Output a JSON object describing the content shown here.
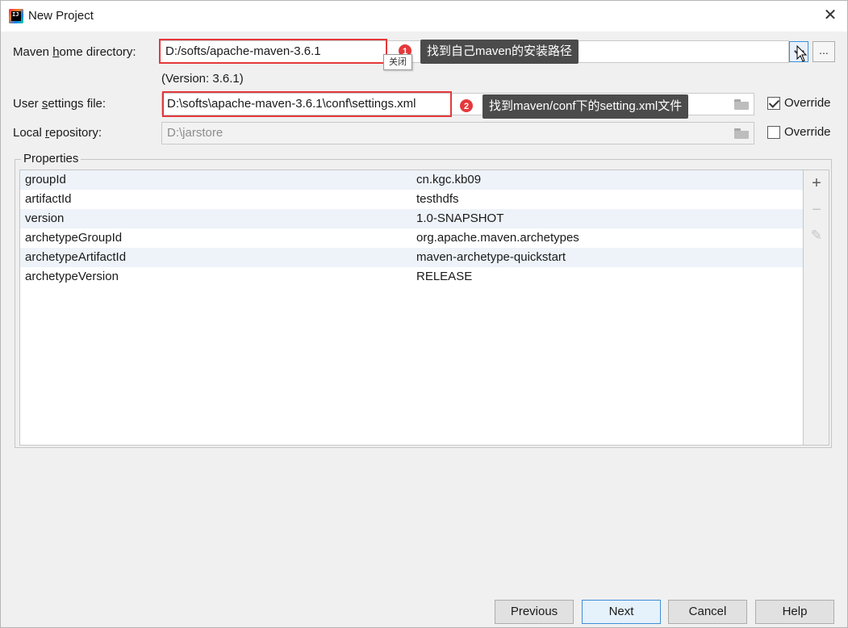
{
  "window": {
    "title": "New Project",
    "close_glyph": "✕"
  },
  "maven_home": {
    "label_before": "Maven ",
    "label_underlined": "h",
    "label_after": "ome directory:",
    "value": "D:/softs/apache-maven-3.6.1",
    "version": "(Version: 3.6.1)",
    "browse_label": "..."
  },
  "user_settings": {
    "label_before": "User ",
    "label_underlined": "s",
    "label_after": "ettings file:",
    "value": "D:\\softs\\apache-maven-3.6.1\\conf\\settings.xml",
    "override_label": "Override",
    "override_checked": true
  },
  "local_repo": {
    "label_before": "Local ",
    "label_underlined": "r",
    "label_after": "epository:",
    "value": "D:\\jarstore",
    "override_label": "Override",
    "override_checked": false
  },
  "annotations": {
    "badge1": "1",
    "callout1": "找到自己maven的安装路径",
    "tooltip_close": "关闭",
    "badge2": "2",
    "callout2": "找到maven/conf下的setting.xml文件",
    "highlight_color": "#e5383b"
  },
  "properties": {
    "title": "Properties",
    "rows": [
      {
        "key": "groupId",
        "value": "cn.kgc.kb09"
      },
      {
        "key": "artifactId",
        "value": "testhdfs"
      },
      {
        "key": "version",
        "value": "1.0-SNAPSHOT"
      },
      {
        "key": "archetypeGroupId",
        "value": "org.apache.maven.archetypes"
      },
      {
        "key": "archetypeArtifactId",
        "value": "maven-archetype-quickstart"
      },
      {
        "key": "archetypeVersion",
        "value": "RELEASE"
      }
    ],
    "tools": {
      "add": "+",
      "remove": "−",
      "edit": "✎"
    }
  },
  "buttons": {
    "previous": "Previous",
    "next": "Next",
    "cancel": "Cancel",
    "help": "Help"
  }
}
